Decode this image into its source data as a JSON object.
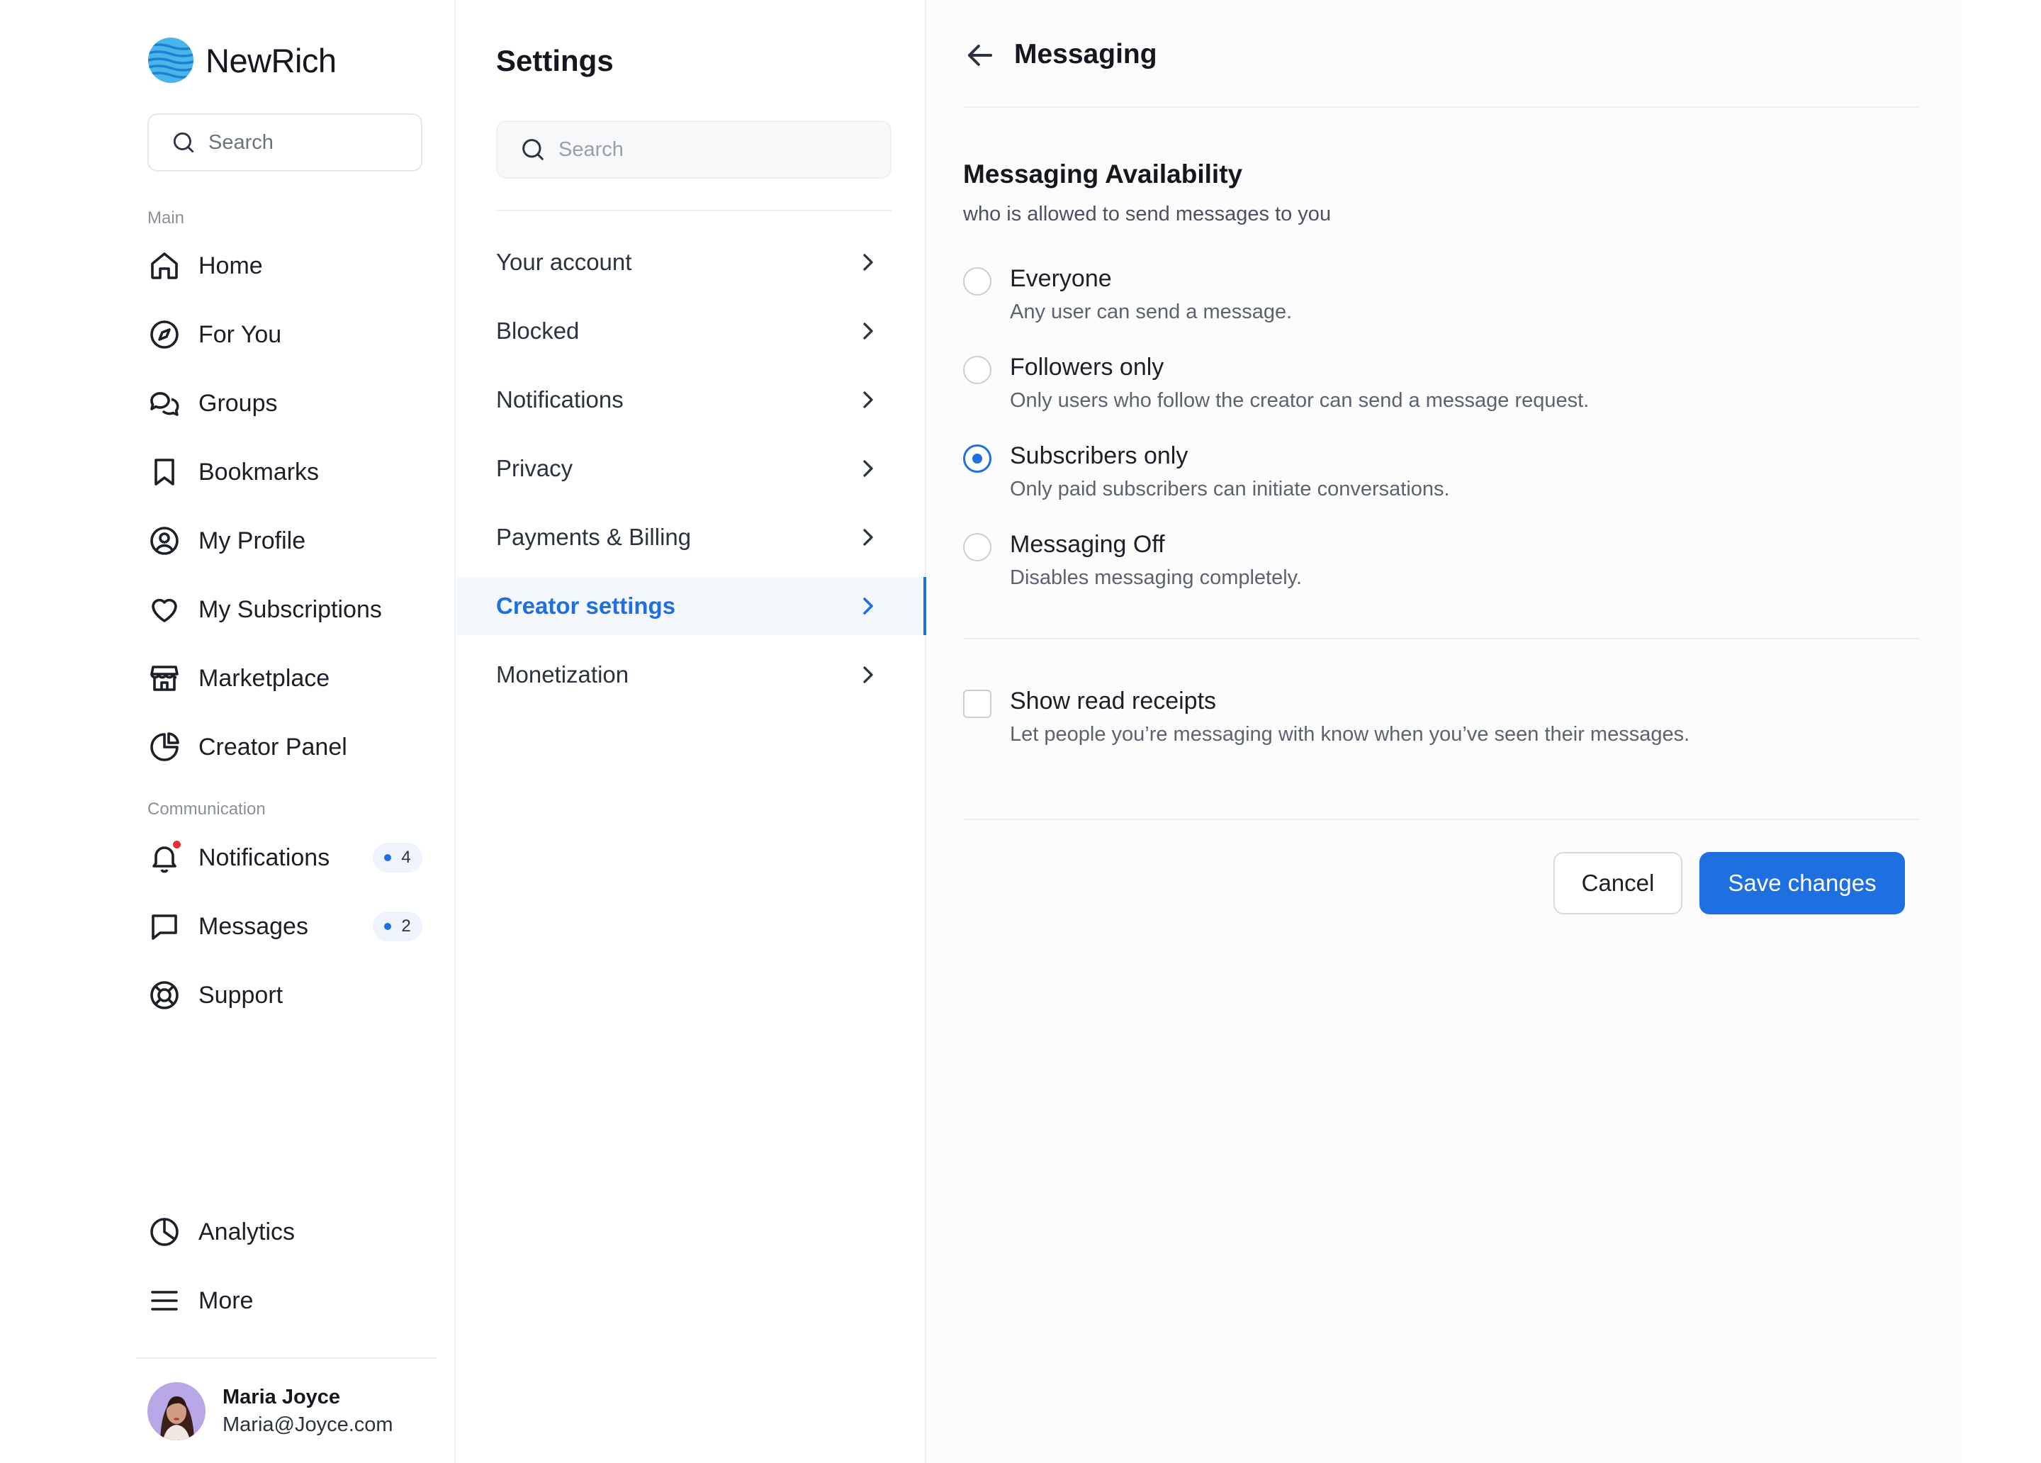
{
  "brand": {
    "name": "NewRich",
    "accent": "#1e6fe0"
  },
  "sidebar": {
    "search_placeholder": "Search",
    "main_label": "Main",
    "main_items": [
      {
        "label": "Home",
        "icon": "home-icon"
      },
      {
        "label": "For You",
        "icon": "compass-icon"
      },
      {
        "label": "Groups",
        "icon": "chat-bubbles-icon"
      },
      {
        "label": "Bookmarks",
        "icon": "bookmark-icon"
      },
      {
        "label": "My Profile",
        "icon": "user-circle-icon"
      },
      {
        "label": "My Subscriptions",
        "icon": "heart-icon"
      },
      {
        "label": "Marketplace",
        "icon": "store-icon"
      },
      {
        "label": "Creator Panel",
        "icon": "pie-chart-icon"
      }
    ],
    "communication_label": "Communication",
    "communication_items": [
      {
        "label": "Notifications",
        "icon": "bell-icon",
        "badge": "4"
      },
      {
        "label": "Messages",
        "icon": "message-square-icon",
        "badge": "2"
      },
      {
        "label": "Support",
        "icon": "lifebuoy-icon"
      }
    ],
    "bottom_items": [
      {
        "label": "Analytics",
        "icon": "clock-chart-icon"
      },
      {
        "label": "More",
        "icon": "menu-icon"
      }
    ],
    "user": {
      "name": "Maria Joyce",
      "email": "Maria@Joyce.com"
    }
  },
  "settings": {
    "title": "Settings",
    "search_placeholder": "Search",
    "items": [
      {
        "label": "Your account"
      },
      {
        "label": "Blocked"
      },
      {
        "label": "Notifications"
      },
      {
        "label": "Privacy"
      },
      {
        "label": "Payments & Billing"
      },
      {
        "label": "Creator settings",
        "active": true
      },
      {
        "label": "Monetization"
      }
    ]
  },
  "main": {
    "title": "Messaging",
    "section_title": "Messaging Availability",
    "section_subtitle": "who is allowed to send messages to you",
    "options": [
      {
        "label": "Everyone",
        "desc": "Any user can send a message.",
        "checked": false
      },
      {
        "label": "Followers only",
        "desc": "Only users who follow the creator can send a message request.",
        "checked": false
      },
      {
        "label": "Subscribers only",
        "desc": "Only paid subscribers can initiate conversations.",
        "checked": true
      },
      {
        "label": "Messaging Off",
        "desc": "Disables messaging completely.",
        "checked": false
      }
    ],
    "read_receipts": {
      "label": "Show read receipts",
      "desc": "Let people you’re messaging with know when you’ve seen their messages.",
      "checked": false
    },
    "cancel_label": "Cancel",
    "save_label": "Save changes"
  }
}
